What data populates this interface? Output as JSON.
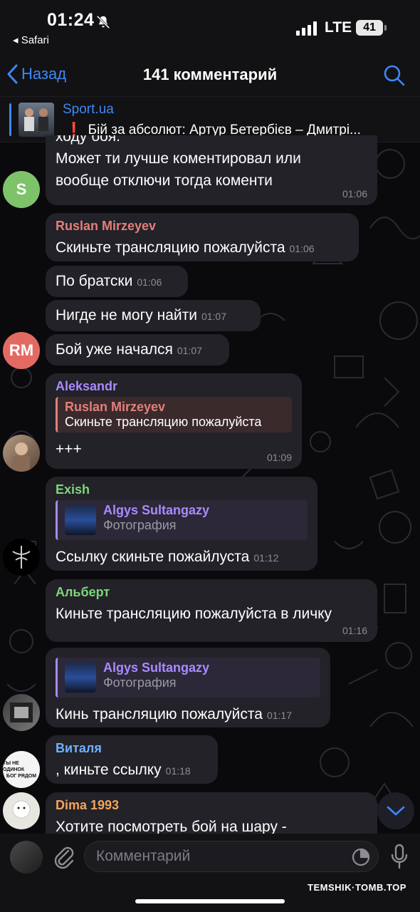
{
  "status_bar": {
    "time": "01:24",
    "back_app": "◂ Safari",
    "network": "LTE",
    "battery": "41"
  },
  "nav": {
    "back_label": "Назад",
    "title": "141 комментарий"
  },
  "pinned": {
    "channel": "Sport.ua",
    "text": "Бій за абсолют: Артур Бетербієв – Дмитрі..."
  },
  "colors": {
    "accent": "#3e88f7",
    "bubble": "#222228",
    "name_ruslan": "#e37f7a",
    "name_aleksandr": "#a98aff",
    "name_exish": "#7ed67a",
    "name_algys": "#a98aff",
    "name_albert": "#7ed67a",
    "name_vitalya": "#6fb1ff",
    "name_dima": "#f5a45c"
  },
  "messages": [
    {
      "text_top": "ходу боя.",
      "text": "Может ти лучше коментировал или вообще отключи тогда коменти",
      "time": "01:06",
      "avatar_letter": "S"
    },
    {
      "author": "Ruslan Mirzeyev",
      "text": "Скиньте трансляцию пожалуйста",
      "time": "01:06"
    },
    {
      "text": "По братски",
      "time": "01:06"
    },
    {
      "text": "Нигде не могу найти",
      "time": "01:07"
    },
    {
      "text": "Бой уже начался",
      "time": "01:07",
      "avatar_letter": "RM"
    },
    {
      "author": "Aleksandr",
      "reply_name": "Ruslan Mirzeyev",
      "reply_text": "Скиньте трансляцию пожалуйста",
      "text": "+++",
      "time": "01:09"
    },
    {
      "author": "Exish",
      "reply_name": "Algys Sultangazy",
      "reply_text": "Фотография",
      "text": "Ссылку скиньте пожайлуста",
      "time": "01:12"
    },
    {
      "author": "Альберт",
      "text": "Киньте трансляцию пожалуйста в личку",
      "time": "01:16"
    },
    {
      "reply_name": "Algys Sultangazy",
      "reply_text": "Фотография",
      "text": "Кинь трансляцию пожалуйста",
      "time": "01:17"
    },
    {
      "author": "Виталя",
      "text": ", киньте ссылку",
      "time": "01:18",
      "avatar_text_1": "ТЫ НЕ ОДИНОК",
      "avatar_text_2": "БОГ РЯДОМ"
    },
    {
      "author": "Dima 1993",
      "text": "Хотите посмотреть бой на шару -"
    }
  ],
  "input": {
    "placeholder": "Комментарий"
  },
  "watermark": "TEMSHIK·TOMB.TOP",
  "icons": [
    "bell-slash-icon",
    "signal-icon",
    "chevron-left-icon",
    "search-icon",
    "paperclip-icon",
    "sticker-icon",
    "microphone-icon",
    "chevron-down-icon"
  ]
}
